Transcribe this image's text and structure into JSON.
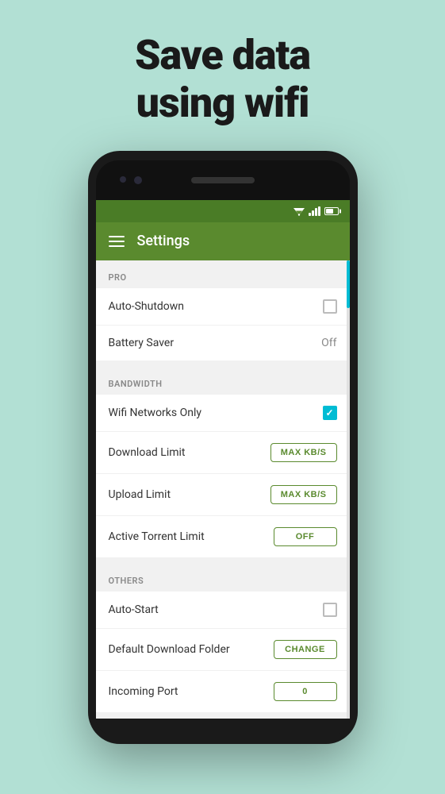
{
  "hero": {
    "line1": "Save data",
    "line2": "using wifi"
  },
  "toolbar": {
    "title": "Settings"
  },
  "sections": [
    {
      "id": "pro",
      "header": "PRO",
      "rows": [
        {
          "label": "Auto-Shutdown",
          "type": "checkbox",
          "checked": false
        },
        {
          "label": "Battery Saver",
          "type": "value",
          "value": "Off"
        }
      ]
    },
    {
      "id": "bandwidth",
      "header": "BANDWIDTH",
      "rows": [
        {
          "label": "Wifi Networks Only",
          "type": "checkbox",
          "checked": true
        },
        {
          "label": "Download Limit",
          "type": "button",
          "btnLabel": "MAX KB/S"
        },
        {
          "label": "Upload Limit",
          "type": "button",
          "btnLabel": "MAX KB/S"
        },
        {
          "label": "Active Torrent Limit",
          "type": "button",
          "btnLabel": "OFF"
        }
      ]
    },
    {
      "id": "others",
      "header": "OTHERS",
      "rows": [
        {
          "label": "Auto-Start",
          "type": "checkbox",
          "checked": false
        },
        {
          "label": "Default Download Folder",
          "type": "button",
          "btnLabel": "CHANGE"
        },
        {
          "label": "Incoming Port",
          "type": "button",
          "btnLabel": "0"
        }
      ]
    }
  ]
}
